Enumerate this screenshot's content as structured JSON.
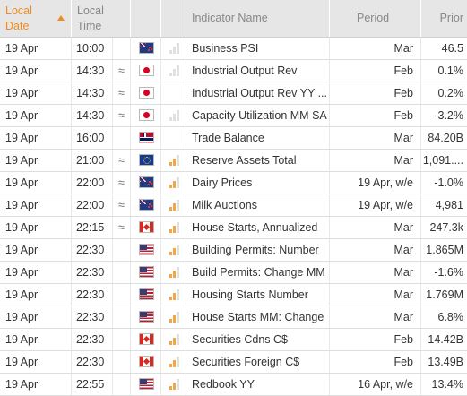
{
  "header": {
    "local_date": [
      "Local",
      "Date"
    ],
    "local_time": [
      "Local",
      "Time"
    ],
    "indicator_name": "Indicator Name",
    "period": "Period",
    "prior": "Prior"
  },
  "rows": [
    {
      "date": "19 Apr",
      "time": "10:00",
      "revised": "",
      "flag": "nz",
      "importance": 0,
      "name": "Business PSI",
      "period": "Mar",
      "prior": "46.5"
    },
    {
      "date": "19 Apr",
      "time": "14:30",
      "revised": "≈",
      "flag": "jp",
      "importance": 0,
      "name": "Industrial Output Rev",
      "period": "Feb",
      "prior": "0.1%"
    },
    {
      "date": "19 Apr",
      "time": "14:30",
      "revised": "≈",
      "flag": "jp",
      "importance": -1,
      "name": "Industrial Output Rev YY ...",
      "period": "Feb",
      "prior": "0.2%"
    },
    {
      "date": "19 Apr",
      "time": "14:30",
      "revised": "≈",
      "flag": "jp",
      "importance": 0,
      "name": "Capacity Utilization MM SA",
      "period": "Feb",
      "prior": "-3.2%"
    },
    {
      "date": "19 Apr",
      "time": "16:00",
      "revised": "",
      "flag": "no",
      "importance": -1,
      "name": "Trade Balance",
      "period": "Mar",
      "prior": "84.20B"
    },
    {
      "date": "19 Apr",
      "time": "21:00",
      "revised": "≈",
      "flag": "eu",
      "importance": 2,
      "name": "Reserve Assets Total",
      "period": "Mar",
      "prior": "1,091...."
    },
    {
      "date": "19 Apr",
      "time": "22:00",
      "revised": "≈",
      "flag": "nz",
      "importance": 2,
      "name": "Dairy Prices",
      "period": "19 Apr, w/e",
      "prior": "-1.0%"
    },
    {
      "date": "19 Apr",
      "time": "22:00",
      "revised": "≈",
      "flag": "nz",
      "importance": 2,
      "name": "Milk Auctions",
      "period": "19 Apr, w/e",
      "prior": "4,981"
    },
    {
      "date": "19 Apr",
      "time": "22:15",
      "revised": "≈",
      "flag": "ca",
      "importance": 2,
      "name": "House Starts, Annualized",
      "period": "Mar",
      "prior": "247.3k"
    },
    {
      "date": "19 Apr",
      "time": "22:30",
      "revised": "",
      "flag": "us",
      "importance": 2,
      "name": "Building Permits: Number",
      "period": "Mar",
      "prior": "1.865M"
    },
    {
      "date": "19 Apr",
      "time": "22:30",
      "revised": "",
      "flag": "us",
      "importance": 2,
      "name": "Build Permits: Change MM",
      "period": "Mar",
      "prior": "-1.6%"
    },
    {
      "date": "19 Apr",
      "time": "22:30",
      "revised": "",
      "flag": "us",
      "importance": 2,
      "name": "Housing Starts Number",
      "period": "Mar",
      "prior": "1.769M"
    },
    {
      "date": "19 Apr",
      "time": "22:30",
      "revised": "",
      "flag": "us",
      "importance": 2,
      "name": "House Starts MM: Change",
      "period": "Mar",
      "prior": "6.8%"
    },
    {
      "date": "19 Apr",
      "time": "22:30",
      "revised": "",
      "flag": "ca",
      "importance": 2,
      "name": "Securities Cdns C$",
      "period": "Feb",
      "prior": "-14.42B"
    },
    {
      "date": "19 Apr",
      "time": "22:30",
      "revised": "",
      "flag": "ca",
      "importance": 2,
      "name": "Securities Foreign C$",
      "period": "Feb",
      "prior": "13.49B"
    },
    {
      "date": "19 Apr",
      "time": "22:55",
      "revised": "",
      "flag": "us",
      "importance": 2,
      "name": "Redbook YY",
      "period": "16 Apr, w/e",
      "prior": "13.4%"
    }
  ],
  "colors": {
    "accent": "#f28b1e",
    "header_bg": "#e6e6e6",
    "bar_on": "#f4a54a",
    "bar_off": "#e0e0e0"
  }
}
